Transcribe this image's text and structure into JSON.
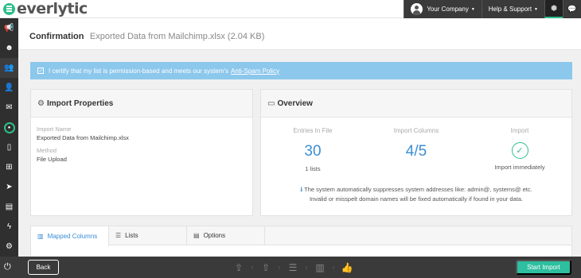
{
  "app": {
    "logo_text": "everlytic"
  },
  "topbar": {
    "company": "Your Company",
    "help": "Help & Support"
  },
  "header": {
    "title": "Confirmation",
    "subtitle": "Exported Data from Mailchimp.xlsx (2.04 KB)"
  },
  "certify": {
    "text": "I certify that my list is permission-based and meets our system's",
    "link": "Anti-Spam Policy"
  },
  "properties": {
    "heading": "Import Properties",
    "import_name_label": "Import Name",
    "import_name_value": "Exported Data from Mailchimp.xlsx",
    "method_label": "Method",
    "method_value": "File Upload"
  },
  "overview": {
    "heading": "Overview",
    "entries_label": "Entries In File",
    "entries_value": "30",
    "entries_sub": "1 lists",
    "columns_label": "Import Columns",
    "columns_value": "4/5",
    "import_label": "Import",
    "import_sub": "Import immediately",
    "note_line1": "The system automatically suppresses system addresses like: admin@, systems@ etc.",
    "note_line2": "Invalid or misspelt domain names will be fixed automatically if found in your data."
  },
  "tabs": [
    {
      "label": "Mapped Columns",
      "active": true
    },
    {
      "label": "Lists",
      "active": false
    },
    {
      "label": "Options",
      "active": false
    }
  ],
  "footer": {
    "back": "Back",
    "start": "Start Import"
  },
  "colors": {
    "accent": "#2dbf8a",
    "link_blue": "#3b8ed4",
    "banner": "#8cc7ec",
    "dark": "#3a3a3a"
  }
}
